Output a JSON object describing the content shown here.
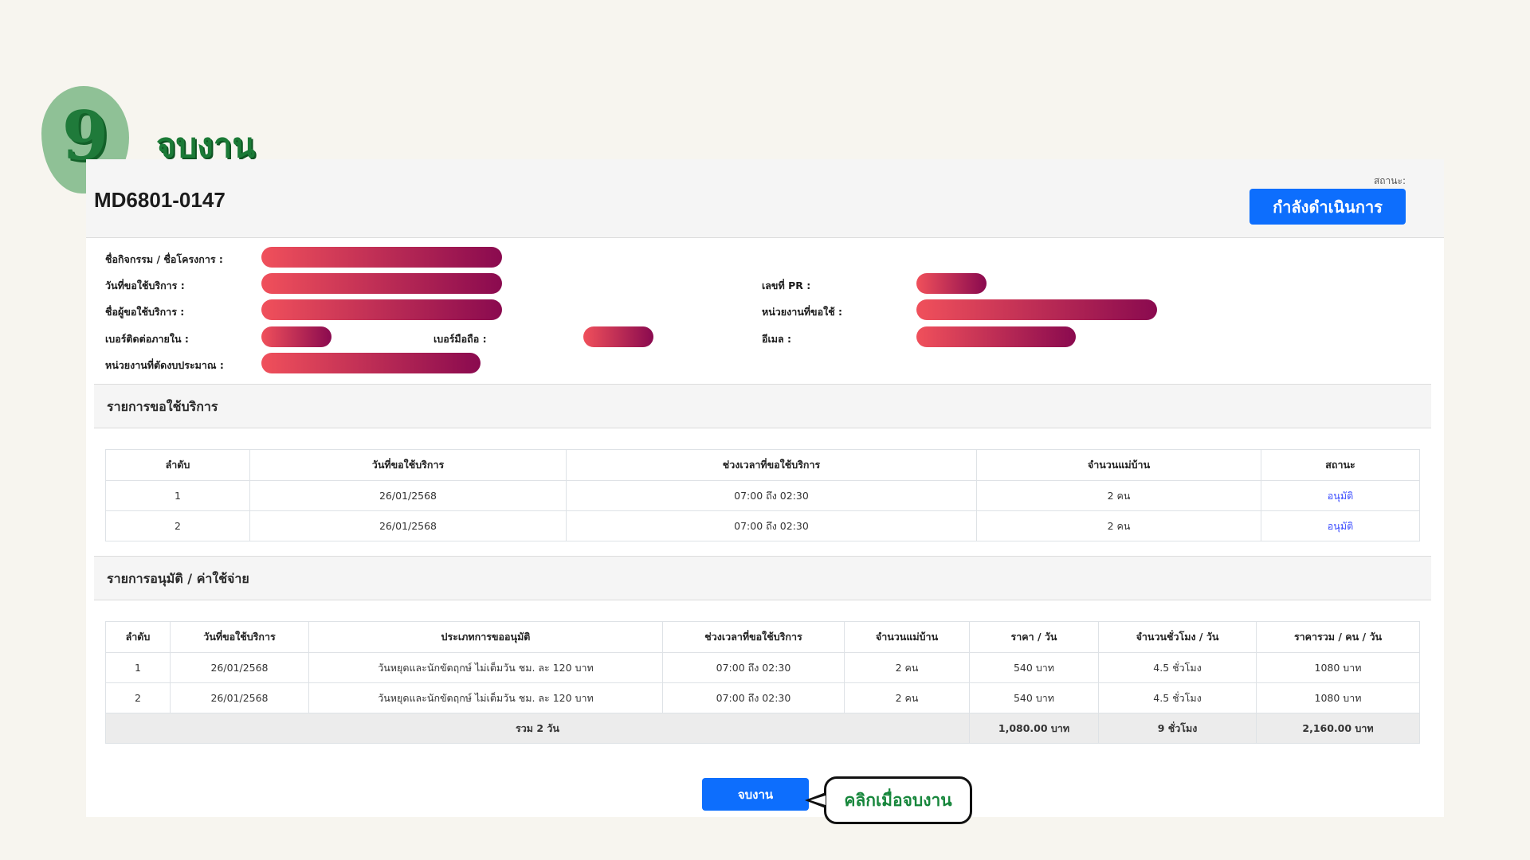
{
  "step": {
    "number": "9",
    "title": "จบงาน"
  },
  "header": {
    "request_code": "MD6801-0147",
    "status_label": "สถานะ:",
    "status_value": "กำลังดำเนินการ"
  },
  "info": {
    "activity_label": "ชื่อกิจกรรม / ชื่อโครงการ :",
    "service_date_label": "วันที่ขอใช้บริการ :",
    "requester_label": "ชื่อผู้ขอใช้บริการ :",
    "internal_phone_label": "เบอร์ติดต่อภายใน :",
    "mobile_label": "เบอร์มือถือ :",
    "budget_unit_label": "หน่วยงานที่ตัดงบประมาณ :",
    "pr_label": "เลขที่ PR :",
    "department_label": "หน่วยงานที่ขอใช้ :",
    "email_label": "อีเมล :"
  },
  "requests_section": {
    "title": "รายการขอใช้บริการ",
    "columns": [
      "ลำดับ",
      "วันที่ขอใช้บริการ",
      "ช่วงเวลาที่ขอใช้บริการ",
      "จำนวนแม่บ้าน",
      "สถานะ"
    ],
    "rows": [
      [
        "1",
        "26/01/2568",
        "07:00 ถึง 02:30",
        "2 คน",
        "อนุมัติ"
      ],
      [
        "2",
        "26/01/2568",
        "07:00 ถึง 02:30",
        "2 คน",
        "อนุมัติ"
      ]
    ]
  },
  "expenses_section": {
    "title": "รายการอนุมัติ / ค่าใช้จ่าย",
    "columns": [
      "ลำดับ",
      "วันที่ขอใช้บริการ",
      "ประเภทการขออนุมัติ",
      "ช่วงเวลาที่ขอใช้บริการ",
      "จำนวนแม่บ้าน",
      "ราคา / วัน",
      "จำนวนชั่วโมง / วัน",
      "ราคารวม / คน / วัน"
    ],
    "rows": [
      [
        "1",
        "26/01/2568",
        "วันหยุดและนักขัตฤกษ์ ไม่เต็มวัน ชม. ละ 120 บาท",
        "07:00 ถึง 02:30",
        "2 คน",
        "540 บาท",
        "4.5 ชั่วโมง",
        "1080 บาท"
      ],
      [
        "2",
        "26/01/2568",
        "วันหยุดและนักขัตฤกษ์ ไม่เต็มวัน ชม. ละ 120 บาท",
        "07:00 ถึง 02:30",
        "2 คน",
        "540 บาท",
        "4.5 ชั่วโมง",
        "1080 บาท"
      ]
    ],
    "total": {
      "label": "รวม 2 วัน",
      "price": "1,080.00 บาท",
      "hours": "9 ชั่วโมง",
      "sum": "2,160.00 บาท"
    }
  },
  "actions": {
    "finish_label": "จบงาน"
  },
  "callout": {
    "text": "คลิกเมื่อจบงาน"
  },
  "colors": {
    "primary": "#0d6efd",
    "approved_link": "#3b4cff",
    "badge_green": "#8fc196",
    "callout_green": "#16863b"
  }
}
